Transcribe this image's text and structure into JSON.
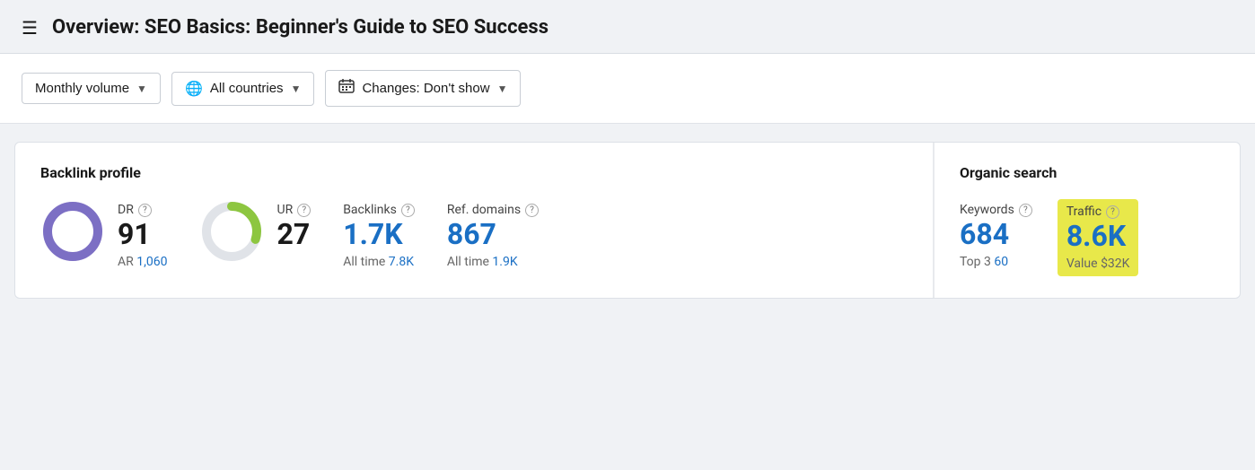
{
  "header": {
    "title": "Overview: SEO Basics: Beginner's Guide to SEO Success",
    "hamburger_icon": "☰"
  },
  "filters": {
    "monthly_volume": {
      "label": "Monthly volume",
      "chevron": "▼"
    },
    "all_countries": {
      "label": "All countries",
      "chevron": "▼",
      "globe_icon": "🌐"
    },
    "changes": {
      "label": "Changes: Don't show",
      "chevron": "▼",
      "calendar_icon": "📅"
    }
  },
  "backlink_profile": {
    "section_title": "Backlink profile",
    "dr": {
      "label": "DR",
      "value": "91",
      "ar_label": "AR",
      "ar_value": "1,060"
    },
    "ur": {
      "label": "UR",
      "value": "27"
    },
    "backlinks": {
      "label": "Backlinks",
      "value": "1.7K",
      "all_time_label": "All time",
      "all_time_value": "7.8K"
    },
    "ref_domains": {
      "label": "Ref. domains",
      "value": "867",
      "all_time_label": "All time",
      "all_time_value": "1.9K"
    }
  },
  "organic_search": {
    "section_title": "Organic search",
    "keywords": {
      "label": "Keywords",
      "value": "684",
      "top3_label": "Top 3",
      "top3_value": "60"
    },
    "traffic": {
      "label": "Traffic",
      "value": "8.6K",
      "value_label": "Value",
      "value_amount": "$32K"
    }
  },
  "colors": {
    "dr_ring": "#7c6fc4",
    "ur_ring_green": "#8dc640",
    "ur_ring_gray": "#e0e3e8",
    "blue": "#1a6fc4",
    "traffic_bg": "#e8e84a"
  }
}
